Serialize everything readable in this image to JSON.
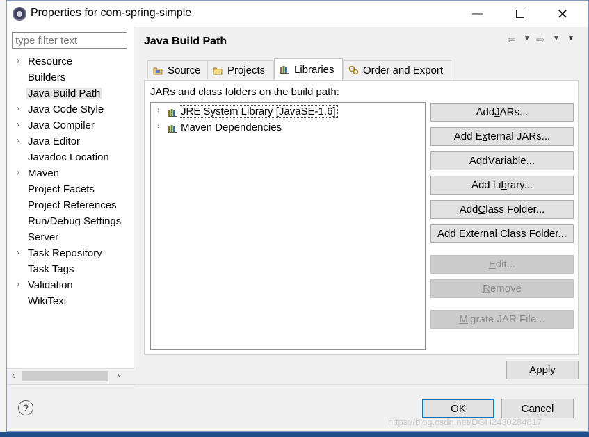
{
  "window": {
    "title": "Properties for com-spring-simple",
    "minimize_glyph": "—",
    "close_glyph": "✕"
  },
  "filter": {
    "placeholder": "type filter text",
    "value": ""
  },
  "tree": {
    "items": [
      {
        "label": "Resource",
        "expandable": true
      },
      {
        "label": "Builders",
        "expandable": false
      },
      {
        "label": "Java Build Path",
        "expandable": false,
        "selected": true
      },
      {
        "label": "Java Code Style",
        "expandable": true
      },
      {
        "label": "Java Compiler",
        "expandable": true
      },
      {
        "label": "Java Editor",
        "expandable": true
      },
      {
        "label": "Javadoc Location",
        "expandable": false
      },
      {
        "label": "Maven",
        "expandable": true
      },
      {
        "label": "Project Facets",
        "expandable": false
      },
      {
        "label": "Project References",
        "expandable": false
      },
      {
        "label": "Run/Debug Settings",
        "expandable": false
      },
      {
        "label": "Server",
        "expandable": false
      },
      {
        "label": "Task Repository",
        "expandable": true
      },
      {
        "label": "Task Tags",
        "expandable": false
      },
      {
        "label": "Validation",
        "expandable": true
      },
      {
        "label": "WikiText",
        "expandable": false
      }
    ],
    "expander_glyph": "›",
    "scroll_left": "‹",
    "scroll_right": "›"
  },
  "page": {
    "title": "Java Build Path"
  },
  "tabs": [
    {
      "label": "Source",
      "active": false
    },
    {
      "label": "Projects",
      "active": false
    },
    {
      "label": "Libraries",
      "active": true
    },
    {
      "label": "Order and Export",
      "active": false
    }
  ],
  "libraries": {
    "label": "JARs and class folders on the build path:",
    "entries": [
      {
        "label": "JRE System Library [JavaSE-1.6]"
      },
      {
        "label": "Maven Dependencies"
      }
    ]
  },
  "buttons": {
    "add_jars": {
      "before": "Add ",
      "key": "J",
      "after": "ARs..."
    },
    "add_external_jars": {
      "before": "Add E",
      "key": "x",
      "after": "ternal JARs..."
    },
    "add_variable": {
      "before": "Add ",
      "key": "V",
      "after": "ariable..."
    },
    "add_library": {
      "before": "Add Li",
      "key": "b",
      "after": "rary..."
    },
    "add_class_folder": {
      "before": "Add ",
      "key": "C",
      "after": "lass Folder..."
    },
    "add_external_class_folder": {
      "before": "Add External Class Fold",
      "key": "e",
      "after": "r..."
    },
    "edit": {
      "before": "",
      "key": "E",
      "after": "dit..."
    },
    "remove": {
      "before": "",
      "key": "R",
      "after": "emove"
    },
    "migrate_jar": {
      "before": "",
      "key": "M",
      "after": "igrate JAR File..."
    },
    "apply": {
      "before": "",
      "key": "A",
      "after": "pply"
    },
    "ok": "OK",
    "cancel": "Cancel",
    "help": "?"
  },
  "watermark": "https://blog.csdn.net/DGH2430284817",
  "colors": {
    "accent": "#0078d7",
    "frame": "#7a9cc8",
    "disabled_text": "#8d8d8d"
  }
}
